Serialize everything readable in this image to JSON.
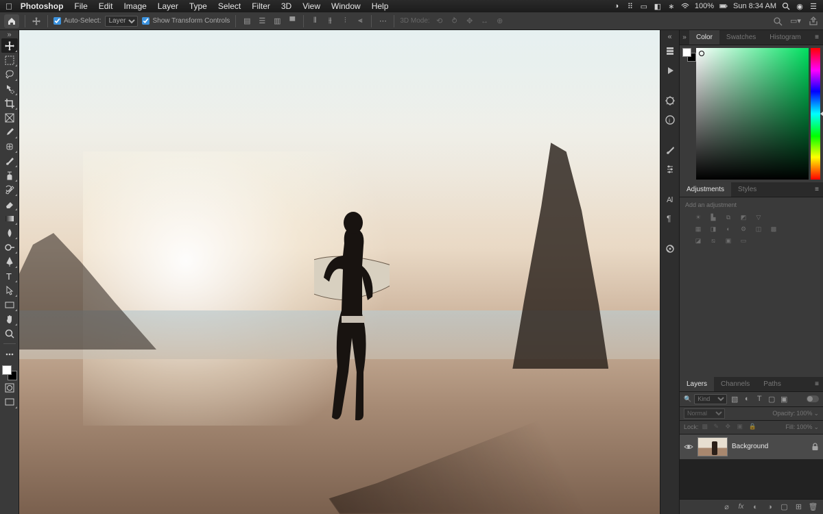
{
  "mac": {
    "app": "Photoshop",
    "menus": [
      "File",
      "Edit",
      "Image",
      "Layer",
      "Type",
      "Select",
      "Filter",
      "3D",
      "View",
      "Window",
      "Help"
    ],
    "battery": "100%",
    "clock": "Sun 8:34 AM"
  },
  "options": {
    "auto_select_label": "Auto-Select:",
    "auto_select_value": "Layer",
    "transform_label": "Show Transform Controls",
    "mode3d_label": "3D Mode:"
  },
  "panel_color": {
    "tabs": [
      "Color",
      "Swatches",
      "Histogram"
    ]
  },
  "panel_adjust": {
    "tabs": [
      "Adjustments",
      "Styles"
    ],
    "hint": "Add an adjustment"
  },
  "panel_layers": {
    "tabs": [
      "Layers",
      "Channels",
      "Paths"
    ],
    "kind": "Kind",
    "blend": "Normal",
    "opacity_label": "Opacity:",
    "opacity_value": "100%",
    "lock_label": "Lock:",
    "fill_label": "Fill:",
    "fill_value": "100%",
    "layer_name": "Background"
  }
}
